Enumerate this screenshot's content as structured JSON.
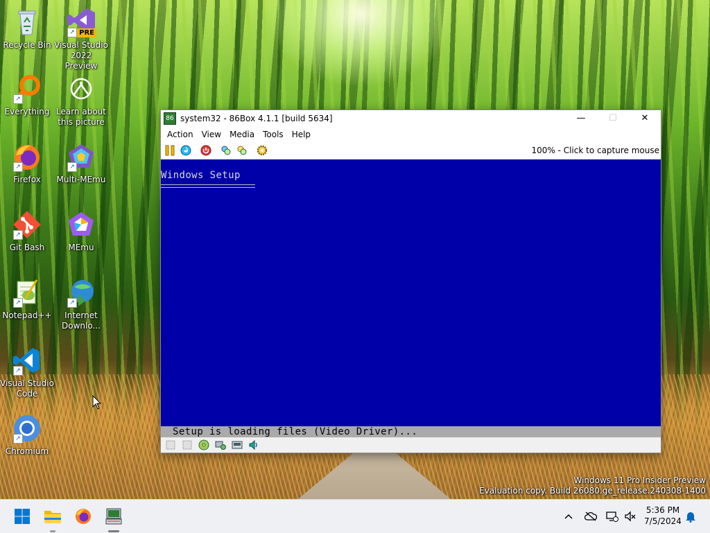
{
  "desktop": {
    "icons": [
      {
        "label": "Recycle Bin"
      },
      {
        "label": "Visual Studio 2022 Preview",
        "badge": "PRE"
      },
      {
        "label": "Everything"
      },
      {
        "label": "Learn about this picture"
      },
      {
        "label": "Firefox"
      },
      {
        "label": "Multi-MEmu"
      },
      {
        "label": "Git Bash"
      },
      {
        "label": "MEmu"
      },
      {
        "label": "Notepad++"
      },
      {
        "label": "Internet Downlo..."
      },
      {
        "label": "Visual Studio Code"
      },
      {
        "label": "Chromium"
      }
    ]
  },
  "window": {
    "title": "system32 - 86Box 4.1.1 [build 5634]",
    "menu": [
      "Action",
      "View",
      "Media",
      "Tools",
      "Help"
    ],
    "capture_status": "100% - Click to capture mouse",
    "screen": {
      "setup_title": "Windows Setup",
      "status_line": "Setup is loading files (Video Driver)..."
    }
  },
  "watermark": {
    "line1": "Windows 11 Pro Insider Preview",
    "line2": "Evaluation copy. Build 26080.ge_release.240308-1400"
  },
  "taskbar": {
    "time": "5:36 PM",
    "date": "7/5/2024"
  },
  "colors": {
    "vm_screen": "#0000a8",
    "status_line": "#aaaaaa",
    "accent": "#0067c0"
  }
}
